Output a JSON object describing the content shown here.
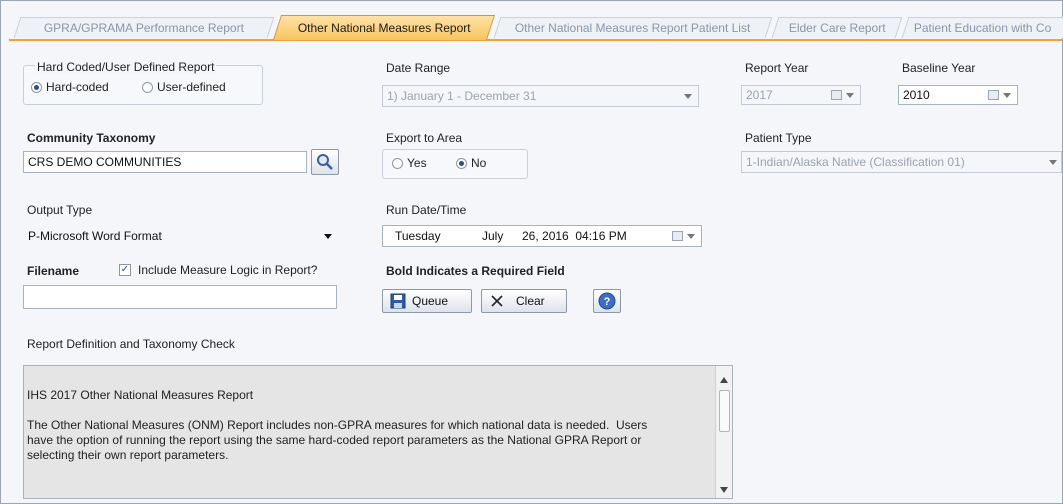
{
  "tabs": [
    {
      "label": "GPRA/GPRAMA Performance Report",
      "active": false
    },
    {
      "label": "Other National Measures Report",
      "active": true
    },
    {
      "label": "Other National Measures Report Patient List",
      "active": false
    },
    {
      "label": "Elder Care Report",
      "active": false
    },
    {
      "label": "Patient Education with Co",
      "active": false
    }
  ],
  "report_kind": {
    "group_label": "Hard Coded/User Defined Report",
    "options": [
      "Hard-coded",
      "User-defined"
    ],
    "selected": "Hard-coded"
  },
  "date_range": {
    "label": "Date Range",
    "value": "1) January 1 - December 31"
  },
  "report_year": {
    "label": "Report Year",
    "value": "2017"
  },
  "baseline_year": {
    "label": "Baseline Year",
    "value": "2010"
  },
  "community": {
    "label": "Community Taxonomy",
    "value": "CRS DEMO COMMUNITIES"
  },
  "export_area": {
    "label": "Export to Area",
    "options": [
      "Yes",
      "No"
    ],
    "selected": "No"
  },
  "patient_type": {
    "label": "Patient Type",
    "value": "1-Indian/Alaska Native (Classification 01)"
  },
  "output_type": {
    "label": "Output Type",
    "value": "P-Microsoft Word Format"
  },
  "run_datetime": {
    "label": "Run Date/Time",
    "weekday": "Tuesday",
    "month": "July",
    "day_year_time": "26, 2016  04:16 PM"
  },
  "filename": {
    "label": "Filename",
    "value": "",
    "include_logic_label": "Include Measure Logic in Report?",
    "include_logic_checked": true
  },
  "required_note": "Bold Indicates a Required Field",
  "buttons": {
    "queue": "Queue",
    "clear": "Clear"
  },
  "definition": {
    "label": "Report Definition and Taxonomy Check",
    "title_line": "IHS 2017 Other National Measures Report",
    "line1": "The Other National Measures (ONM) Report includes non-GPRA measures for which national data is needed.  Users",
    "line2": "have the option of running the report using the same hard-coded report parameters as the National GPRA Report or",
    "line3": "selecting their own report parameters."
  }
}
